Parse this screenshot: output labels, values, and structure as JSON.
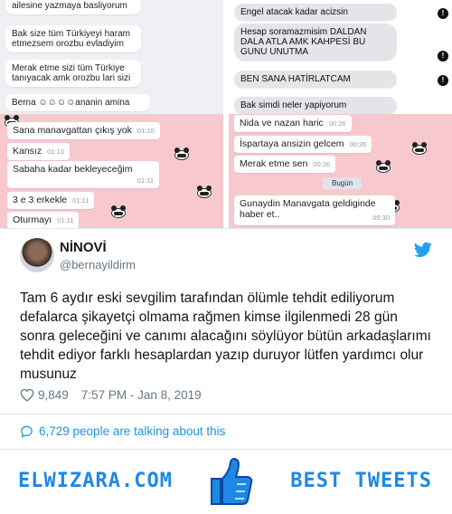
{
  "screenshots": {
    "top_left": [
      {
        "text": "ailesine yazmaya basliyorum"
      },
      {
        "text": "Bak size tüm Türkiyeyi haram\netmezsem orozbu evladiyim"
      },
      {
        "text": "Merak etme  sizi tüm Türkiye\ntanıyacak amk orozbu lari sizi"
      },
      {
        "text": "Berna ☺☺☺☺ananin amina"
      }
    ],
    "top_right": [
      {
        "text": "Engel atacak kadar acizsin"
      },
      {
        "text": "Hesap soramazmisim  DALDAN\nDALA ATLA AMK KAHPESİ BU\nGUNU UNUTMA"
      },
      {
        "text": "BEN SANA HATİRLATCAM"
      },
      {
        "text": "Bak simdi neler yapiyorum"
      }
    ],
    "bottom_left": [
      {
        "text": "Sana manavgattan çıkış yok",
        "time": "01:10"
      },
      {
        "text": "Kansız",
        "time": "01:10"
      },
      {
        "text": "Sabaha kadar bekleyeceğim",
        "time": "01:11"
      },
      {
        "text": "3 e 3 erkekle",
        "time": "01:11"
      },
      {
        "text": "Oturmayı",
        "time": "01:11"
      }
    ],
    "bottom_right": [
      {
        "text": "Nida ve nazan haric",
        "time": "00:26"
      },
      {
        "text": "İspartaya ansizin gelcem",
        "time": "00:26"
      },
      {
        "text": "Merak etme sen",
        "time": "00:26"
      },
      {
        "text": "Gunaydin Manavgata geldiginde\nhaber et..",
        "time": "09:30"
      }
    ],
    "date_chip": "Bugün",
    "tick_icon": "!"
  },
  "tweet": {
    "name": "NİNOVİ",
    "handle": "@bernayildirm",
    "text": "Tam 6 aydır eski sevgilim tarafından ölümle tehdit ediliyorum defalarca şikayetçi olmama rağmen kimse ilgilenmedi 28 gün sonra geleceğini ve canımı alacağını söylüyor bütün arkadaşlarımı tehdit ediyor farklı hesaplardan yazıp duruyor lütfen yardımcı olur musunuz",
    "likes": "9,849",
    "timestamp": "7:57 PM - Jan 8, 2019",
    "talking": "6,729 people are talking about this",
    "twitter_blue": "#1da1f2"
  },
  "footer": {
    "left_brand": "ELWIZARA.COM",
    "right_brand": "BEST TWEETS",
    "brand_color": "#1e88e5"
  }
}
